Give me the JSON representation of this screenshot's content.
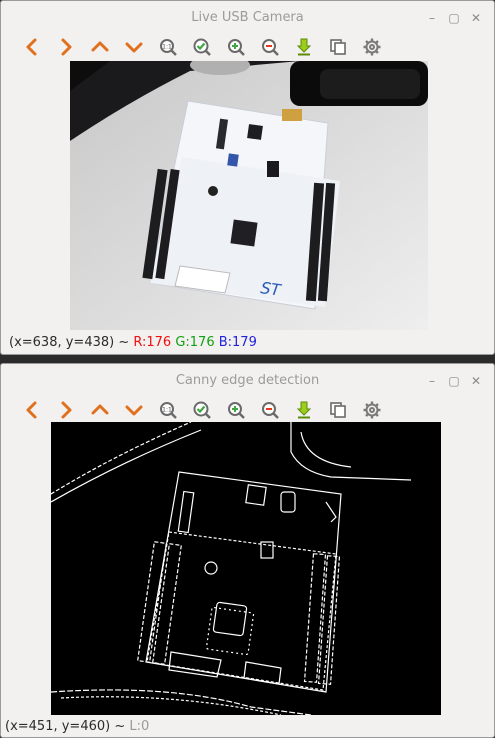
{
  "windows": [
    {
      "title": "Live USB Camera",
      "status": {
        "coords": "(x=638, y=438) ~ ",
        "r": "R:176",
        "g": " G:176",
        "b": " B:179"
      }
    },
    {
      "title": "Canny edge detection",
      "status": {
        "coords": "(x=451, y=460) ~ ",
        "l": "L:0"
      }
    }
  ],
  "toolbar_icons": [
    "arrow-left-icon",
    "arrow-right-icon",
    "arrow-up-icon",
    "arrow-down-icon",
    "zoom-actual-icon",
    "zoom-fit-icon",
    "zoom-in-icon",
    "zoom-out-icon",
    "save-icon",
    "copy-icon",
    "settings-icon"
  ],
  "window_controls": [
    "minimize-icon",
    "maximize-icon",
    "close-icon"
  ],
  "colors": {
    "orange": "#e0701e",
    "green": "#3fa83f",
    "ygreen": "#9ccd1a",
    "gray": "#6a6a6a",
    "r": "#ee1111",
    "g": "#11a011",
    "b": "#2222dd"
  }
}
